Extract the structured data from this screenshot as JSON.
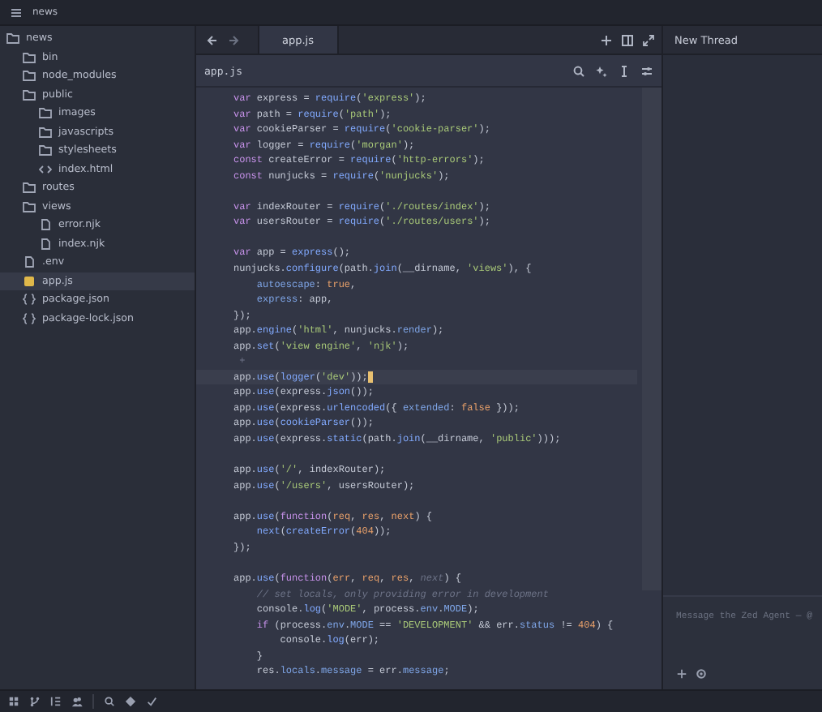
{
  "title_bar": {
    "project": "news"
  },
  "sidebar": {
    "items": [
      {
        "label": "news",
        "kind": "folder",
        "selected": false,
        "children": [
          {
            "label": "bin",
            "kind": "folder",
            "selected": false
          },
          {
            "label": "node_modules",
            "kind": "folder",
            "selected": false
          },
          {
            "label": "public",
            "kind": "folder",
            "selected": false,
            "children": [
              {
                "label": "images",
                "kind": "folder",
                "selected": false
              },
              {
                "label": "javascripts",
                "kind": "folder",
                "selected": false
              },
              {
                "label": "stylesheets",
                "kind": "folder",
                "selected": false
              },
              {
                "label": "index.html",
                "kind": "html",
                "selected": false
              }
            ]
          },
          {
            "label": "routes",
            "kind": "folder",
            "selected": false
          },
          {
            "label": "views",
            "kind": "folder",
            "selected": false,
            "children": [
              {
                "label": "error.njk",
                "kind": "file",
                "selected": false
              },
              {
                "label": "index.njk",
                "kind": "file",
                "selected": false
              }
            ]
          },
          {
            "label": ".env",
            "kind": "file",
            "selected": false
          },
          {
            "label": "app.js",
            "kind": "js",
            "selected": true
          },
          {
            "label": "package.json",
            "kind": "json",
            "selected": false
          },
          {
            "label": "package-lock.json",
            "kind": "json",
            "selected": false
          }
        ]
      }
    ]
  },
  "tabs": [
    {
      "label": "app.js",
      "selected": true
    }
  ],
  "breadcrumb": "app.js",
  "code": [
    {
      "kind": "code",
      "current": false,
      "tokens": [
        {
          "text": "var ",
          "kind": "k"
        },
        {
          "text": "express = ",
          "kind": "v"
        },
        {
          "text": "require",
          "kind": "f"
        },
        {
          "text": "(",
          "kind": "v"
        },
        {
          "text": "'express'",
          "kind": "s"
        },
        {
          "text": ");",
          "kind": "v"
        }
      ]
    },
    {
      "kind": "code",
      "current": false,
      "tokens": [
        {
          "text": "var ",
          "kind": "k"
        },
        {
          "text": "path = ",
          "kind": "v"
        },
        {
          "text": "require",
          "kind": "f"
        },
        {
          "text": "(",
          "kind": "v"
        },
        {
          "text": "'path'",
          "kind": "s"
        },
        {
          "text": ");",
          "kind": "v"
        }
      ]
    },
    {
      "kind": "code",
      "current": false,
      "tokens": [
        {
          "text": "var ",
          "kind": "k"
        },
        {
          "text": "cookieParser = ",
          "kind": "v"
        },
        {
          "text": "require",
          "kind": "f"
        },
        {
          "text": "(",
          "kind": "v"
        },
        {
          "text": "'cookie-parser'",
          "kind": "s"
        },
        {
          "text": ");",
          "kind": "v"
        }
      ]
    },
    {
      "kind": "code",
      "current": false,
      "tokens": [
        {
          "text": "var ",
          "kind": "k"
        },
        {
          "text": "logger = ",
          "kind": "v"
        },
        {
          "text": "require",
          "kind": "f"
        },
        {
          "text": "(",
          "kind": "v"
        },
        {
          "text": "'morgan'",
          "kind": "s"
        },
        {
          "text": ");",
          "kind": "v"
        }
      ]
    },
    {
      "kind": "code",
      "current": false,
      "tokens": [
        {
          "text": "const ",
          "kind": "k"
        },
        {
          "text": "createError = ",
          "kind": "v"
        },
        {
          "text": "require",
          "kind": "f"
        },
        {
          "text": "(",
          "kind": "v"
        },
        {
          "text": "'http-errors'",
          "kind": "s"
        },
        {
          "text": ");",
          "kind": "v"
        }
      ]
    },
    {
      "kind": "code",
      "current": false,
      "tokens": [
        {
          "text": "const ",
          "kind": "k"
        },
        {
          "text": "nunjucks = ",
          "kind": "v"
        },
        {
          "text": "require",
          "kind": "f"
        },
        {
          "text": "(",
          "kind": "v"
        },
        {
          "text": "'nunjucks'",
          "kind": "s"
        },
        {
          "text": ");",
          "kind": "v"
        }
      ]
    },
    {
      "kind": "blank"
    },
    {
      "kind": "code",
      "current": false,
      "tokens": [
        {
          "text": "var ",
          "kind": "k"
        },
        {
          "text": "indexRouter = ",
          "kind": "v"
        },
        {
          "text": "require",
          "kind": "f"
        },
        {
          "text": "(",
          "kind": "v"
        },
        {
          "text": "'./routes/index'",
          "kind": "s"
        },
        {
          "text": ");",
          "kind": "v"
        }
      ]
    },
    {
      "kind": "code",
      "current": false,
      "tokens": [
        {
          "text": "var ",
          "kind": "k"
        },
        {
          "text": "usersRouter = ",
          "kind": "v"
        },
        {
          "text": "require",
          "kind": "f"
        },
        {
          "text": "(",
          "kind": "v"
        },
        {
          "text": "'./routes/users'",
          "kind": "s"
        },
        {
          "text": ");",
          "kind": "v"
        }
      ]
    },
    {
      "kind": "blank"
    },
    {
      "kind": "code",
      "current": false,
      "tokens": [
        {
          "text": "var ",
          "kind": "k"
        },
        {
          "text": "app = ",
          "kind": "v"
        },
        {
          "text": "express",
          "kind": "f"
        },
        {
          "text": "();",
          "kind": "v"
        }
      ]
    },
    {
      "kind": "code",
      "current": false,
      "tokens": [
        {
          "text": "nunjucks.",
          "kind": "v"
        },
        {
          "text": "configure",
          "kind": "f"
        },
        {
          "text": "(path.",
          "kind": "v"
        },
        {
          "text": "join",
          "kind": "f"
        },
        {
          "text": "(__dirname, ",
          "kind": "v"
        },
        {
          "text": "'views'",
          "kind": "s"
        },
        {
          "text": "), {",
          "kind": "v"
        }
      ]
    },
    {
      "kind": "code",
      "current": false,
      "tokens": [
        {
          "text": "    autoescape",
          "kind": "p"
        },
        {
          "text": ": ",
          "kind": "v"
        },
        {
          "text": "true",
          "kind": "n"
        },
        {
          "text": ",",
          "kind": "v"
        }
      ]
    },
    {
      "kind": "code",
      "current": false,
      "tokens": [
        {
          "text": "    express",
          "kind": "p"
        },
        {
          "text": ": app,",
          "kind": "v"
        }
      ]
    },
    {
      "kind": "code",
      "current": false,
      "tokens": [
        {
          "text": "});",
          "kind": "v"
        }
      ]
    },
    {
      "kind": "code",
      "current": false,
      "tokens": [
        {
          "text": "app.",
          "kind": "v"
        },
        {
          "text": "engine",
          "kind": "f"
        },
        {
          "text": "(",
          "kind": "v"
        },
        {
          "text": "'html'",
          "kind": "s"
        },
        {
          "text": ", nunjucks.",
          "kind": "v"
        },
        {
          "text": "render",
          "kind": "p"
        },
        {
          "text": ");",
          "kind": "v"
        }
      ]
    },
    {
      "kind": "code",
      "current": false,
      "tokens": [
        {
          "text": "app.",
          "kind": "v"
        },
        {
          "text": "set",
          "kind": "f"
        },
        {
          "text": "(",
          "kind": "v"
        },
        {
          "text": "'view engine'",
          "kind": "s"
        },
        {
          "text": ", ",
          "kind": "v"
        },
        {
          "text": "'njk'",
          "kind": "s"
        },
        {
          "text": ");",
          "kind": "v"
        }
      ]
    },
    {
      "kind": "hint",
      "current": false,
      "tokens": [
        {
          "text": " +",
          "kind": "c"
        }
      ]
    },
    {
      "kind": "code",
      "current": true,
      "tokens": [
        {
          "text": "app.",
          "kind": "v"
        },
        {
          "text": "use",
          "kind": "f"
        },
        {
          "text": "(",
          "kind": "v"
        },
        {
          "text": "logger",
          "kind": "f"
        },
        {
          "text": "(",
          "kind": "v"
        },
        {
          "text": "'dev'",
          "kind": "s"
        },
        {
          "text": "));",
          "kind": "v"
        }
      ]
    },
    {
      "kind": "code",
      "current": false,
      "tokens": [
        {
          "text": "app.",
          "kind": "v"
        },
        {
          "text": "use",
          "kind": "f"
        },
        {
          "text": "(express.",
          "kind": "v"
        },
        {
          "text": "json",
          "kind": "f"
        },
        {
          "text": "());",
          "kind": "v"
        }
      ]
    },
    {
      "kind": "code",
      "current": false,
      "tokens": [
        {
          "text": "app.",
          "kind": "v"
        },
        {
          "text": "use",
          "kind": "f"
        },
        {
          "text": "(express.",
          "kind": "v"
        },
        {
          "text": "urlencoded",
          "kind": "f"
        },
        {
          "text": "({ ",
          "kind": "v"
        },
        {
          "text": "extended",
          "kind": "p"
        },
        {
          "text": ": ",
          "kind": "v"
        },
        {
          "text": "false",
          "kind": "n"
        },
        {
          "text": " }));",
          "kind": "v"
        }
      ]
    },
    {
      "kind": "code",
      "current": false,
      "tokens": [
        {
          "text": "app.",
          "kind": "v"
        },
        {
          "text": "use",
          "kind": "f"
        },
        {
          "text": "(",
          "kind": "v"
        },
        {
          "text": "cookieParser",
          "kind": "f"
        },
        {
          "text": "());",
          "kind": "v"
        }
      ]
    },
    {
      "kind": "code",
      "current": false,
      "tokens": [
        {
          "text": "app.",
          "kind": "v"
        },
        {
          "text": "use",
          "kind": "f"
        },
        {
          "text": "(express.",
          "kind": "v"
        },
        {
          "text": "static",
          "kind": "f"
        },
        {
          "text": "(path.",
          "kind": "v"
        },
        {
          "text": "join",
          "kind": "f"
        },
        {
          "text": "(__dirname, ",
          "kind": "v"
        },
        {
          "text": "'public'",
          "kind": "s"
        },
        {
          "text": ")));",
          "kind": "v"
        }
      ]
    },
    {
      "kind": "blank"
    },
    {
      "kind": "code",
      "current": false,
      "tokens": [
        {
          "text": "app.",
          "kind": "v"
        },
        {
          "text": "use",
          "kind": "f"
        },
        {
          "text": "(",
          "kind": "v"
        },
        {
          "text": "'/'",
          "kind": "s"
        },
        {
          "text": ", indexRouter);",
          "kind": "v"
        }
      ]
    },
    {
      "kind": "code",
      "current": false,
      "tokens": [
        {
          "text": "app.",
          "kind": "v"
        },
        {
          "text": "use",
          "kind": "f"
        },
        {
          "text": "(",
          "kind": "v"
        },
        {
          "text": "'/users'",
          "kind": "s"
        },
        {
          "text": ", usersRouter);",
          "kind": "v"
        }
      ]
    },
    {
      "kind": "blank"
    },
    {
      "kind": "code",
      "current": false,
      "tokens": [
        {
          "text": "app.",
          "kind": "v"
        },
        {
          "text": "use",
          "kind": "f"
        },
        {
          "text": "(",
          "kind": "v"
        },
        {
          "text": "function",
          "kind": "k"
        },
        {
          "text": "(",
          "kind": "v"
        },
        {
          "text": "req",
          "kind": "n"
        },
        {
          "text": ", ",
          "kind": "v"
        },
        {
          "text": "res",
          "kind": "n"
        },
        {
          "text": ", ",
          "kind": "v"
        },
        {
          "text": "next",
          "kind": "n"
        },
        {
          "text": ") {",
          "kind": "v"
        }
      ]
    },
    {
      "kind": "code",
      "current": false,
      "tokens": [
        {
          "text": "    next",
          "kind": "f"
        },
        {
          "text": "(",
          "kind": "v"
        },
        {
          "text": "createError",
          "kind": "f"
        },
        {
          "text": "(",
          "kind": "v"
        },
        {
          "text": "404",
          "kind": "n"
        },
        {
          "text": "));",
          "kind": "v"
        }
      ]
    },
    {
      "kind": "code",
      "current": false,
      "tokens": [
        {
          "text": "});",
          "kind": "v"
        }
      ]
    },
    {
      "kind": "blank"
    },
    {
      "kind": "code",
      "current": false,
      "tokens": [
        {
          "text": "app.",
          "kind": "v"
        },
        {
          "text": "use",
          "kind": "f"
        },
        {
          "text": "(",
          "kind": "v"
        },
        {
          "text": "function",
          "kind": "k"
        },
        {
          "text": "(",
          "kind": "v"
        },
        {
          "text": "err",
          "kind": "n"
        },
        {
          "text": ", ",
          "kind": "v"
        },
        {
          "text": "req",
          "kind": "n"
        },
        {
          "text": ", ",
          "kind": "v"
        },
        {
          "text": "res",
          "kind": "n"
        },
        {
          "text": ", ",
          "kind": "v"
        },
        {
          "text": "next",
          "kind": "c"
        },
        {
          "text": ") {",
          "kind": "v"
        }
      ]
    },
    {
      "kind": "code",
      "current": false,
      "tokens": [
        {
          "text": "    // set locals, only providing error in development",
          "kind": "c"
        }
      ]
    },
    {
      "kind": "code",
      "current": false,
      "tokens": [
        {
          "text": "    console.",
          "kind": "v"
        },
        {
          "text": "log",
          "kind": "f"
        },
        {
          "text": "(",
          "kind": "v"
        },
        {
          "text": "'MODE'",
          "kind": "s"
        },
        {
          "text": ", process.",
          "kind": "v"
        },
        {
          "text": "env",
          "kind": "p"
        },
        {
          "text": ".",
          "kind": "v"
        },
        {
          "text": "MODE",
          "kind": "p"
        },
        {
          "text": ");",
          "kind": "v"
        }
      ]
    },
    {
      "kind": "code",
      "current": false,
      "tokens": [
        {
          "text": "    if ",
          "kind": "k"
        },
        {
          "text": "(process.",
          "kind": "v"
        },
        {
          "text": "env",
          "kind": "p"
        },
        {
          "text": ".",
          "kind": "v"
        },
        {
          "text": "MODE",
          "kind": "p"
        },
        {
          "text": " == ",
          "kind": "v"
        },
        {
          "text": "'DEVELOPMENT'",
          "kind": "s"
        },
        {
          "text": " && err.",
          "kind": "v"
        },
        {
          "text": "status",
          "kind": "p"
        },
        {
          "text": " != ",
          "kind": "v"
        },
        {
          "text": "404",
          "kind": "n"
        },
        {
          "text": ") {",
          "kind": "v"
        }
      ]
    },
    {
      "kind": "code",
      "current": false,
      "tokens": [
        {
          "text": "        console.",
          "kind": "v"
        },
        {
          "text": "log",
          "kind": "f"
        },
        {
          "text": "(err);",
          "kind": "v"
        }
      ]
    },
    {
      "kind": "code",
      "current": false,
      "tokens": [
        {
          "text": "    }",
          "kind": "v"
        }
      ]
    },
    {
      "kind": "code",
      "current": false,
      "tokens": [
        {
          "text": "    res.",
          "kind": "v"
        },
        {
          "text": "locals",
          "kind": "p"
        },
        {
          "text": ".",
          "kind": "v"
        },
        {
          "text": "message",
          "kind": "p"
        },
        {
          "text": " = err.",
          "kind": "v"
        },
        {
          "text": "message",
          "kind": "p"
        },
        {
          "text": ";",
          "kind": "v"
        }
      ]
    }
  ],
  "agent_panel": {
    "title": "New Thread",
    "placeholder": "Message the Zed Agent — @"
  }
}
